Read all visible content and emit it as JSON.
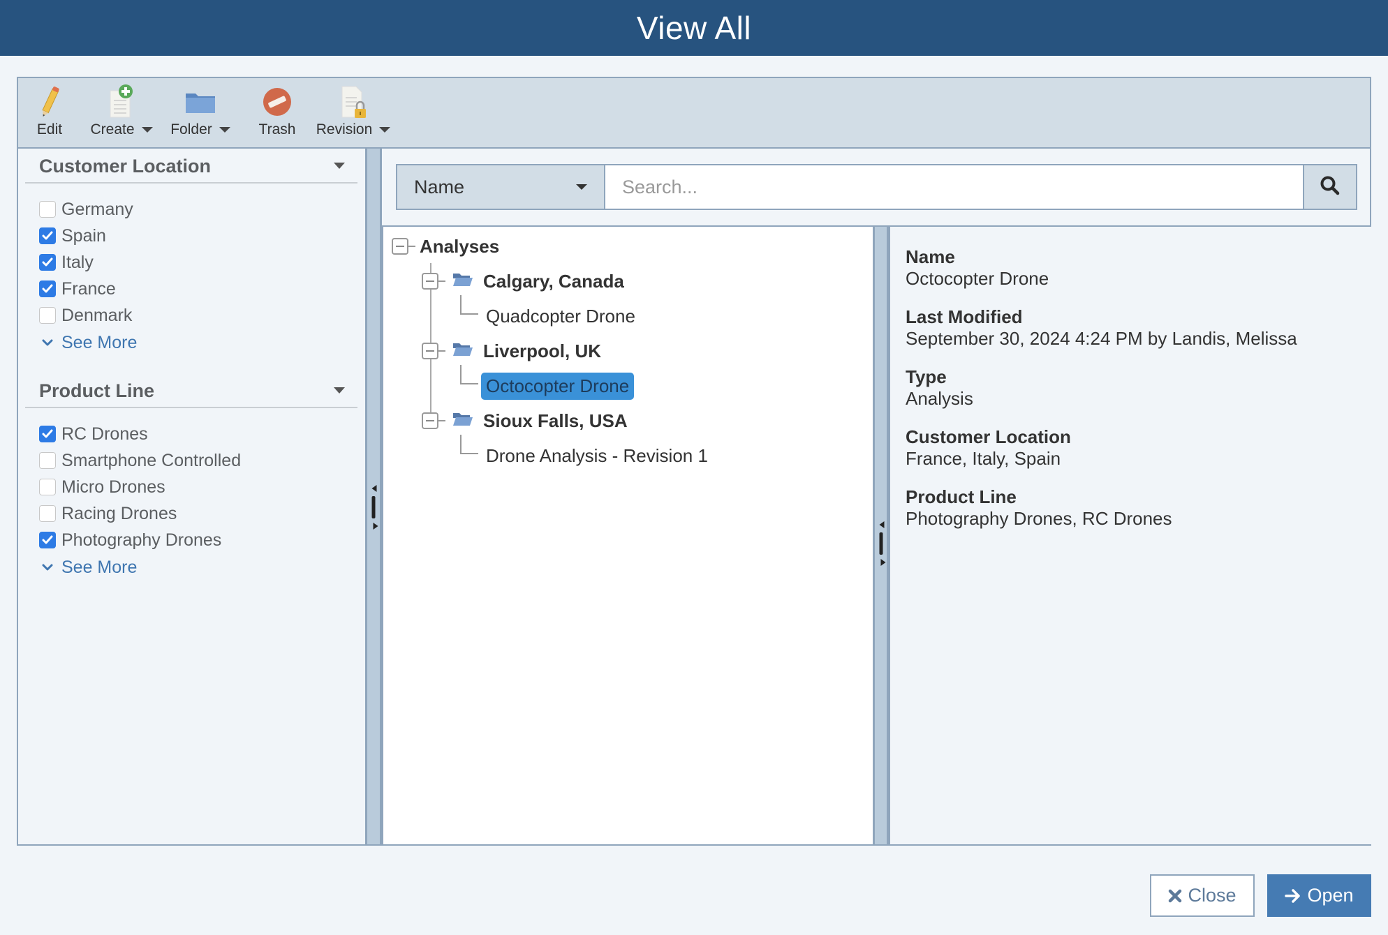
{
  "header": {
    "title": "View All"
  },
  "toolbar": {
    "buttons": [
      {
        "label": "Edit",
        "icon": "pencil-icon",
        "has_menu": false
      },
      {
        "label": "Create",
        "icon": "new-document-icon",
        "has_menu": true
      },
      {
        "label": "Folder",
        "icon": "folder-icon",
        "has_menu": true
      },
      {
        "label": "Trash",
        "icon": "trash-icon",
        "has_menu": false
      },
      {
        "label": "Revision",
        "icon": "locked-document-icon",
        "has_menu": true
      }
    ]
  },
  "filters": {
    "customer_location": {
      "title": "Customer Location",
      "items": [
        {
          "label": "Germany",
          "checked": false
        },
        {
          "label": "Spain",
          "checked": true
        },
        {
          "label": "Italy",
          "checked": true
        },
        {
          "label": "France",
          "checked": true
        },
        {
          "label": "Denmark",
          "checked": false
        }
      ],
      "see_more": "See More"
    },
    "product_line": {
      "title": "Product Line",
      "items": [
        {
          "label": "RC Drones",
          "checked": true
        },
        {
          "label": "Smartphone Controlled",
          "checked": false
        },
        {
          "label": "Micro Drones",
          "checked": false
        },
        {
          "label": "Racing Drones",
          "checked": false
        },
        {
          "label": "Photography Drones",
          "checked": true
        }
      ],
      "see_more": "See More"
    }
  },
  "search": {
    "field_select": "Name",
    "placeholder": "Search...",
    "value": ""
  },
  "tree": {
    "root": "Analyses",
    "folders": [
      {
        "label": "Calgary, Canada",
        "children": [
          "Quadcopter Drone"
        ]
      },
      {
        "label": "Liverpool, UK",
        "children": [
          "Octocopter Drone"
        ]
      },
      {
        "label": "Sioux Falls, USA",
        "children": [
          "Drone Analysis - Revision 1"
        ]
      }
    ],
    "selected": "Octocopter Drone"
  },
  "details": {
    "fields": [
      {
        "label": "Name",
        "value": "Octocopter Drone"
      },
      {
        "label": "Last Modified",
        "value": "September 30, 2024 4:24 PM by Landis, Melissa"
      },
      {
        "label": "Type",
        "value": "Analysis"
      },
      {
        "label": "Customer Location",
        "value": "France, Italy, Spain"
      },
      {
        "label": "Product Line",
        "value": "Photography Drones, RC Drones"
      }
    ]
  },
  "footer": {
    "close_label": "Close",
    "open_label": "Open"
  },
  "colors": {
    "header_bg": "#27537f",
    "accent": "#457bb3",
    "checkbox": "#2d7be5",
    "selection": "#3a91d8",
    "link": "#3f76b0"
  }
}
